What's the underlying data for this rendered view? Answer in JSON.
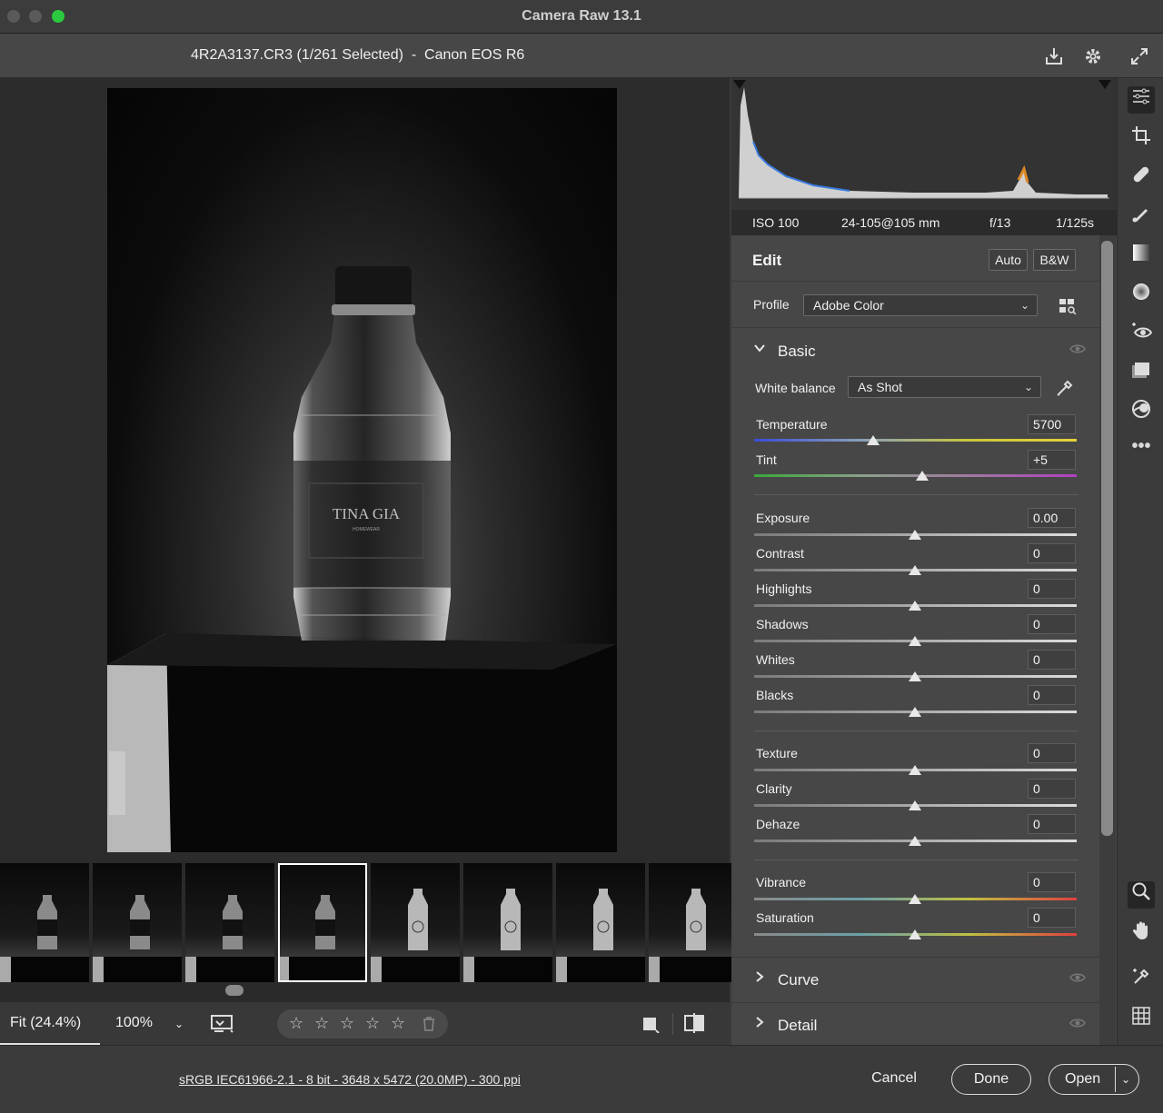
{
  "window": {
    "title": "Camera Raw 13.1"
  },
  "header": {
    "file_info": "4R2A3137.CR3 (1/261 Selected)  -  Canon EOS R6",
    "icons": [
      "save-icon",
      "gear-icon",
      "fullscreen-icon"
    ]
  },
  "photo": {
    "label_text": "TINA GIA",
    "label_sub": "HOMEWEAR"
  },
  "exif": {
    "iso": "ISO 100",
    "lens": "24-105@105 mm",
    "aperture": "f/13",
    "shutter": "1/125s"
  },
  "edit": {
    "title": "Edit",
    "auto_label": "Auto",
    "bw_label": "B&W",
    "profile_label": "Profile",
    "profile_value": "Adobe Color"
  },
  "basic": {
    "title": "Basic",
    "wb_label": "White balance",
    "wb_value": "As Shot",
    "temperature": {
      "label": "Temperature",
      "value": "5700"
    },
    "tint": {
      "label": "Tint",
      "value": "+5"
    },
    "exposure": {
      "label": "Exposure",
      "value": "0.00"
    },
    "contrast": {
      "label": "Contrast",
      "value": "0"
    },
    "highlights": {
      "label": "Highlights",
      "value": "0"
    },
    "shadows": {
      "label": "Shadows",
      "value": "0"
    },
    "whites": {
      "label": "Whites",
      "value": "0"
    },
    "blacks": {
      "label": "Blacks",
      "value": "0"
    },
    "texture": {
      "label": "Texture",
      "value": "0"
    },
    "clarity": {
      "label": "Clarity",
      "value": "0"
    },
    "dehaze": {
      "label": "Dehaze",
      "value": "0"
    },
    "vibrance": {
      "label": "Vibrance",
      "value": "0"
    },
    "saturation": {
      "label": "Saturation",
      "value": "0"
    }
  },
  "sections": {
    "curve": "Curve",
    "detail": "Detail"
  },
  "bottombar": {
    "fit": "Fit (24.4%)",
    "zoom100": "100%"
  },
  "footer": {
    "info_link": "sRGB IEC61966-2.1 - 8 bit - 3648 x 5472 (20.0MP) - 300 ppi",
    "cancel": "Cancel",
    "done": "Done",
    "open": "Open"
  },
  "filmstrip": {
    "count": 8,
    "selected_index": 3
  },
  "colors": {
    "accent_green": "#2bc840",
    "panel_bg": "#474747"
  }
}
